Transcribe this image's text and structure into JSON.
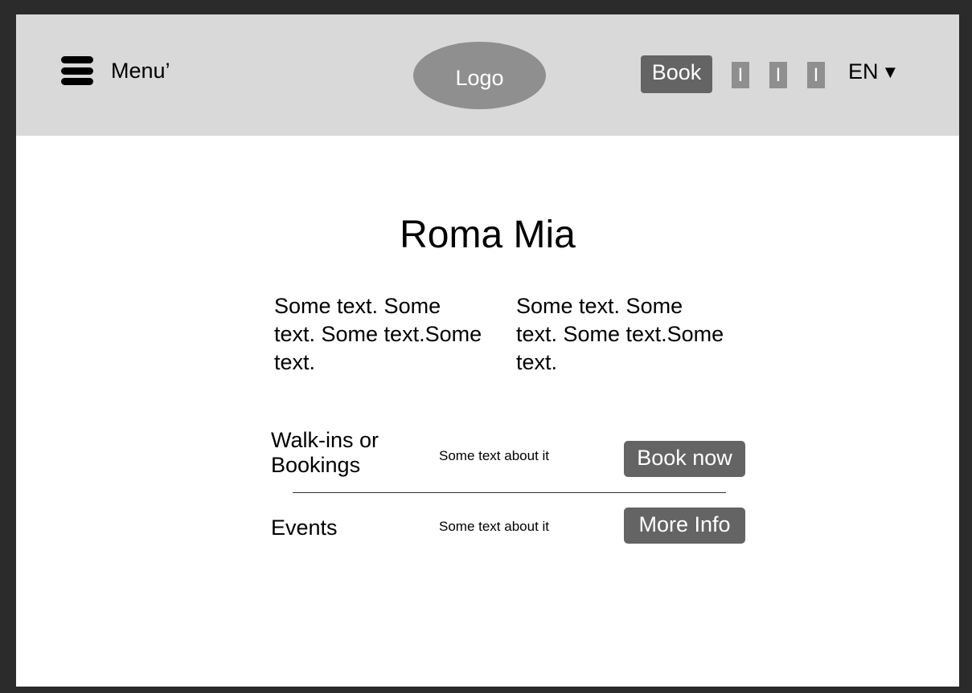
{
  "header": {
    "menu_label": "Menu’",
    "logo_text": "Logo",
    "book_label": "Book",
    "social_links": [
      "I",
      "I",
      "I"
    ],
    "language": "EN",
    "language_caret": "▼"
  },
  "main": {
    "title": "Roma Mia",
    "text_blocks": [
      "Some text. Some text. Some text.Some text.",
      "Some text. Some text. Some text.Some text."
    ],
    "rows": [
      {
        "label": "Walk-ins or Bookings",
        "description": "Some text about it",
        "button": "Book now"
      },
      {
        "label": "Events",
        "description": "Some text about it",
        "button": "More Info"
      }
    ]
  },
  "colors": {
    "header_bg": "#d9d9d9",
    "button_bg": "#646464",
    "logo_bg": "#8f8f8f",
    "frame_border": "#2b2b2b"
  }
}
